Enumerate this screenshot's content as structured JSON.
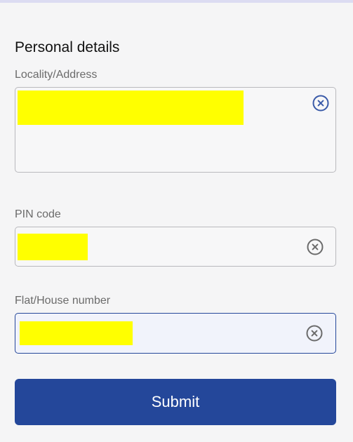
{
  "form": {
    "title": "Personal details",
    "fields": [
      {
        "label": "Locality/Address",
        "value": "",
        "redacted": true,
        "clear_icon": "close-circle-icon",
        "focused": false
      },
      {
        "label": "PIN code",
        "value": "",
        "redacted": true,
        "clear_icon": "close-circle-icon",
        "focused": false
      },
      {
        "label": "Flat/House number",
        "value": "",
        "redacted": true,
        "clear_icon": "close-circle-icon",
        "focused": true
      }
    ],
    "submit_label": "Submit"
  },
  "colors": {
    "primary": "#24479a",
    "background": "#f5f5f6",
    "redaction": "#ffff00",
    "label": "#6b6b6b",
    "icon_blue": "#3a5aa8",
    "icon_grey": "#6b6b6b"
  }
}
